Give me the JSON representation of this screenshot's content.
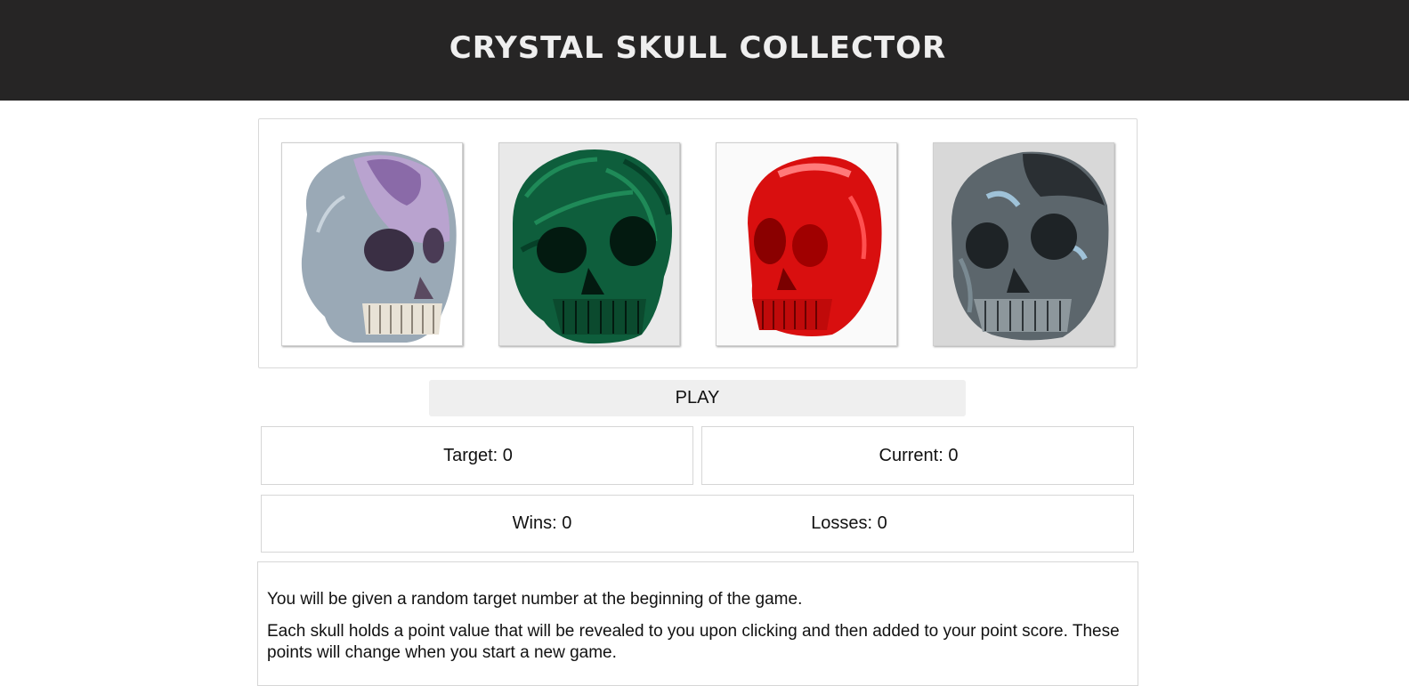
{
  "header": {
    "title": "CRYSTAL SKULL COLLECTOR"
  },
  "skulls": [
    {
      "name": "amethyst-geode-skull",
      "color": "#b8a6c9"
    },
    {
      "name": "malachite-skull",
      "color": "#0d5a3a"
    },
    {
      "name": "red-crystal-skull",
      "color": "#e01010"
    },
    {
      "name": "labradorite-skull",
      "color": "#5d6a70"
    }
  ],
  "controls": {
    "play_label": "PLAY"
  },
  "scores": {
    "target_label": "Target: 0",
    "current_label": "Current: 0",
    "wins_label": "Wins: 0",
    "losses_label": "Losses: 0"
  },
  "instructions": {
    "line1": "You will be given a random target number at the beginning of the game.",
    "line2": "Each skull holds a point value that will be revealed to you upon clicking and then added to your point score. These points will change when you start a new game."
  }
}
